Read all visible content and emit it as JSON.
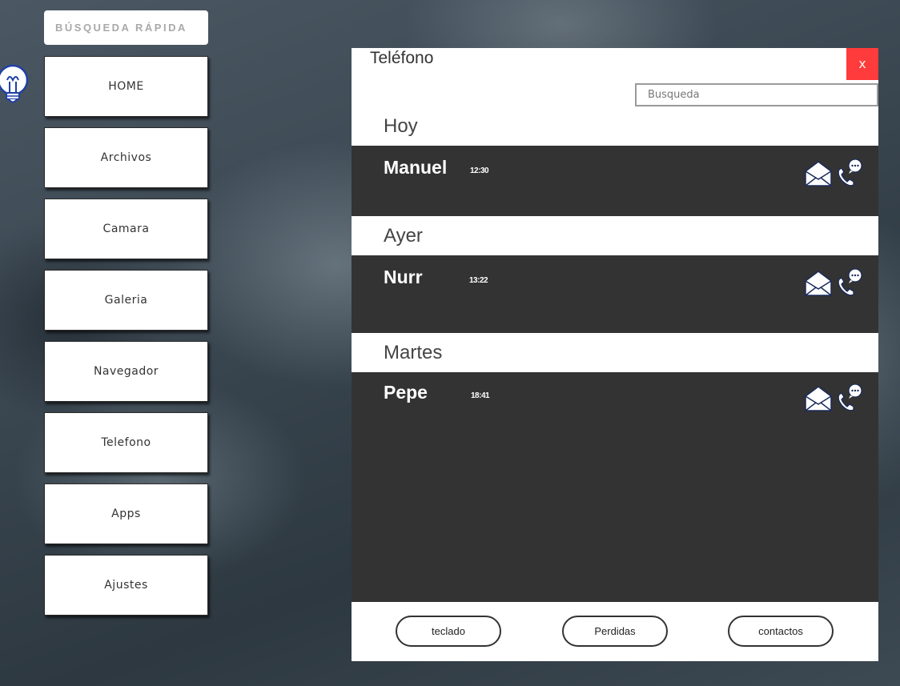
{
  "sidebar": {
    "quick_search": "BÚSQUEDA RÁPIDA",
    "items": [
      "HOME",
      "Archivos",
      "Camara",
      "Galeria",
      "Navegador",
      "Telefono",
      "Apps",
      "Ajustes"
    ]
  },
  "phone": {
    "title": "Teléfono",
    "close_label": "x",
    "search_placeholder": "Busqueda",
    "groups": [
      {
        "day": "Hoy",
        "name": "Manuel",
        "time": "12:30"
      },
      {
        "day": "Ayer",
        "name": "Nurr",
        "time": "13:22"
      },
      {
        "day": "Martes",
        "name": "Pepe",
        "time": "18:41"
      }
    ],
    "footer": {
      "keypad": "teclado",
      "missed": "Perdidas",
      "contacts": "contactos"
    }
  },
  "colors": {
    "close": "#ff3b3b",
    "panel": "#333333"
  },
  "icons": [
    "lightbulb-icon",
    "envelope-icon",
    "phone-chat-icon"
  ]
}
